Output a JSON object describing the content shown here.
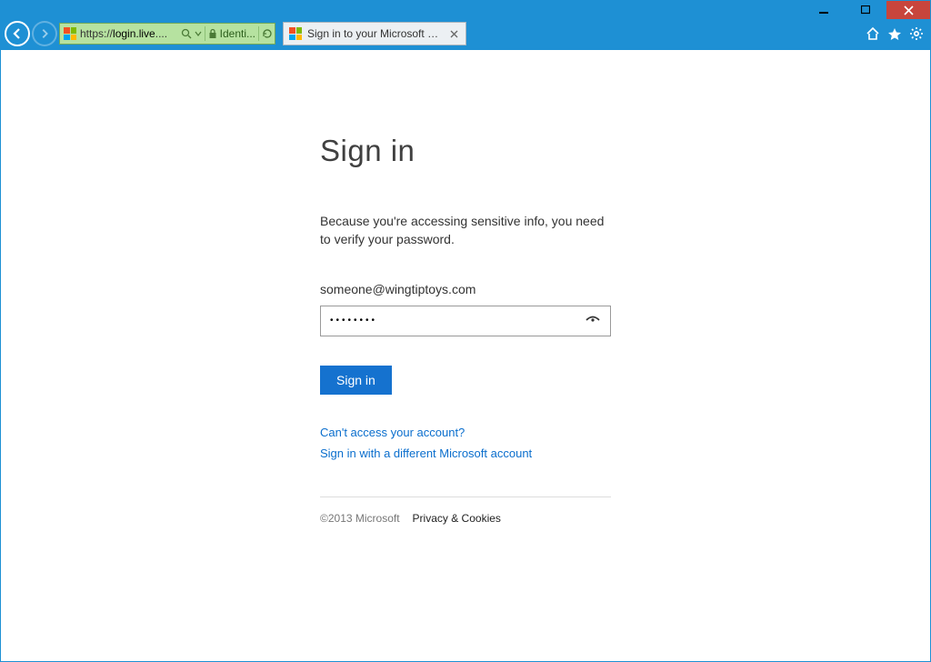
{
  "browser": {
    "url_display": "https://login.live....",
    "identity_label": "Identi...",
    "tab_title": "Sign in to your Microsoft ac..."
  },
  "page": {
    "heading": "Sign in",
    "message": "Because you're accessing sensitive info, you need to verify your password.",
    "email": "someone@wingtiptoys.com",
    "password_masked": "••••••••",
    "signin_button": "Sign in",
    "link_cant_access": "Can't access your account?",
    "link_different_account": "Sign in with a different Microsoft account",
    "footer_copyright": "©2013 Microsoft",
    "footer_privacy": "Privacy & Cookies"
  }
}
